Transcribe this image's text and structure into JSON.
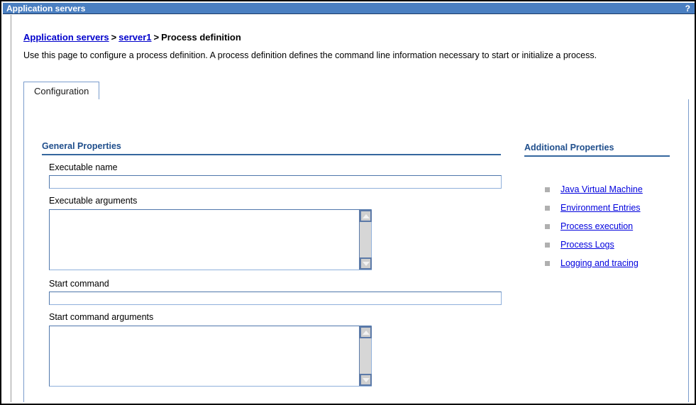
{
  "window": {
    "title": "Application servers",
    "help_icon": "question-mark-icon",
    "help_label": "?"
  },
  "breadcrumb": {
    "items": [
      {
        "label": "Application servers",
        "link": true
      },
      {
        "label": "server1",
        "link": true
      },
      {
        "label": "Process definition",
        "link": false
      }
    ],
    "separator": ">"
  },
  "intro": {
    "text": "Use this page to configure a process definition. A process definition defines the command line information necessary to start or initialize a process."
  },
  "tabs": [
    {
      "label": "Configuration",
      "selected": true
    }
  ],
  "general_properties": {
    "heading": "General Properties",
    "fields": [
      {
        "label": "Executable name",
        "type": "text",
        "value": "",
        "placeholder": ""
      },
      {
        "label": "Executable arguments",
        "type": "textarea",
        "value": "",
        "placeholder": ""
      },
      {
        "label": "Start command",
        "type": "text",
        "value": "",
        "placeholder": ""
      },
      {
        "label": "Start command arguments",
        "type": "textarea",
        "value": "",
        "placeholder": ""
      }
    ]
  },
  "additional_properties": {
    "heading": "Additional Properties",
    "links": [
      {
        "label": "Java Virtual Machine"
      },
      {
        "label": "Environment Entries"
      },
      {
        "label": "Process execution"
      },
      {
        "label": "Process Logs"
      },
      {
        "label": "Logging and tracing"
      }
    ]
  },
  "colors": {
    "titlebar_bg": "#4a7fc1",
    "link": "#0000dd",
    "heading": "#1f4e8c",
    "border": "#7a9ccc",
    "input_border": "#4f76ab"
  }
}
